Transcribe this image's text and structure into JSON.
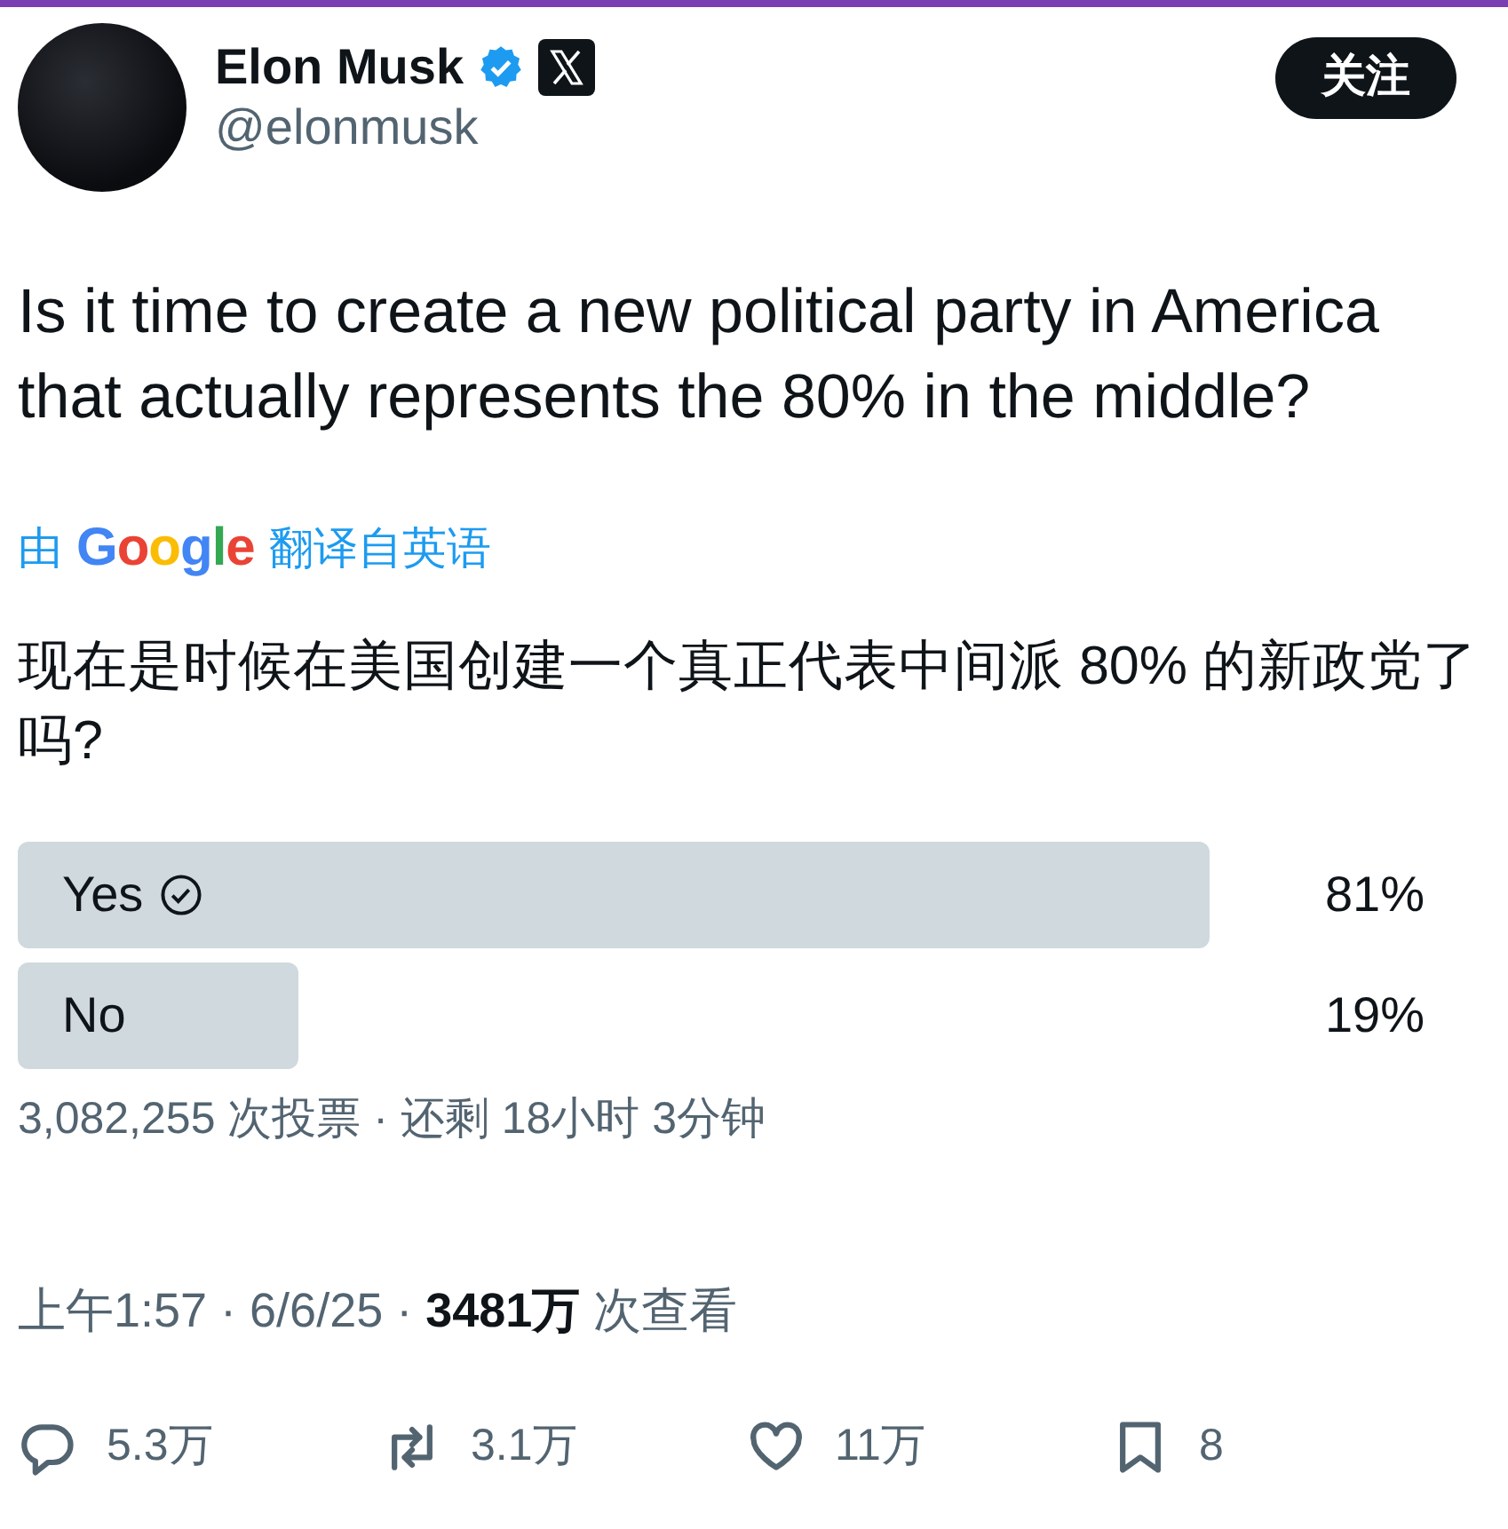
{
  "author": {
    "name": "Elon Musk",
    "handle": "@elonmusk",
    "verified": true
  },
  "follow_button": "关注",
  "text": "Is it time to create a new political party in America that actually represents the 80% in the middle?",
  "translation": {
    "prefix": "由",
    "provider": "Google",
    "suffix": "翻译自英语",
    "text": "现在是时候在美国创建一个真正代表中间派 80% 的新政党了吗?"
  },
  "poll": {
    "options": [
      {
        "label": "Yes",
        "percent": "81%",
        "selected": true
      },
      {
        "label": "No",
        "percent": "19%",
        "selected": false
      }
    ],
    "summary": "3,082,255 次投票 · 还剩 18小时 3分钟"
  },
  "meta": "上午1:57 · 6/6/25 · **3481万** 次查看",
  "actions": [
    {
      "kind": "reply",
      "count": "5.3万"
    },
    {
      "kind": "repost",
      "count": "3.1万"
    },
    {
      "kind": "like",
      "count": "11万"
    },
    {
      "kind": "bookmark",
      "count": "8"
    }
  ]
}
